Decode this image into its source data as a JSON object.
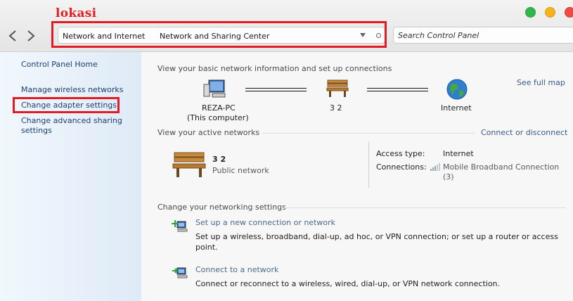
{
  "annotation": {
    "title": "lokasi"
  },
  "window": {
    "controls": [
      "minimize",
      "zoom",
      "close"
    ]
  },
  "address_bar": {
    "breadcrumbs": [
      "Network and Internet",
      "Network and Sharing Center"
    ]
  },
  "search": {
    "placeholder": "Search Control Panel"
  },
  "sidebar": {
    "items": [
      {
        "label": "Control Panel Home"
      },
      {
        "label": "Manage wireless networks"
      },
      {
        "label": "Change adapter settings"
      },
      {
        "label": "Change advanced sharing settings"
      }
    ]
  },
  "main": {
    "basic_heading": "View your basic network information and set up connections",
    "see_full_map": "See full map",
    "map": {
      "computer": {
        "name": "REZA-PC",
        "subtitle": "(This computer)"
      },
      "network": {
        "name": "3 2"
      },
      "internet": {
        "name": "Internet"
      }
    },
    "active": {
      "heading": "View your active networks",
      "connect_link": "Connect or disconnect",
      "network_name": "3 2",
      "network_type": "Public network",
      "access_type_label": "Access type:",
      "access_type_value": "Internet",
      "connections_label": "Connections:",
      "connection_name": "Mobile Broadband Connection",
      "connection_index": "(3)"
    },
    "settings": {
      "heading": "Change your networking settings",
      "tasks": [
        {
          "title": "Set up a new connection or network",
          "description": "Set up a wireless, broadband, dial-up, ad hoc, or VPN connection; or set up a router or access point."
        },
        {
          "title": "Connect to a network",
          "description": "Connect or reconnect to a wireless, wired, dial-up, or VPN network connection."
        }
      ]
    }
  },
  "colors": {
    "highlight": "#e31b23",
    "annotation_text": "#e02020",
    "link": "#1c3f70",
    "sidebar_bg": "#e6eff9"
  }
}
